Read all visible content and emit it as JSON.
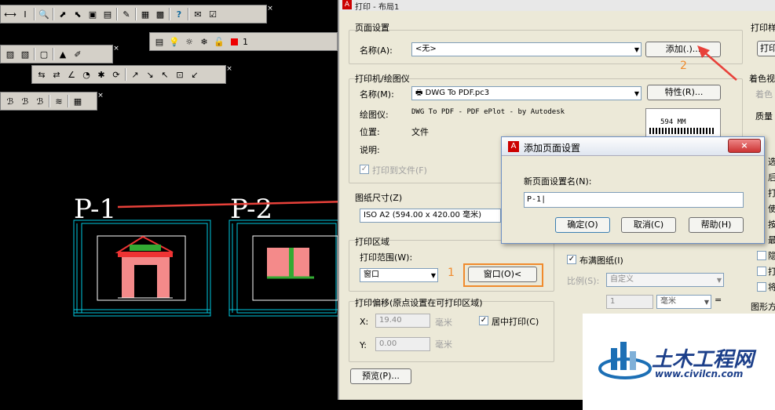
{
  "cad": {
    "toolbar_row5_label": "1",
    "label_p1": "P-1",
    "label_p2": "P-2"
  },
  "dialog": {
    "title": "打印 - 布局1",
    "page_setup": {
      "group": "页面设置",
      "name_label": "名称(A):",
      "name_value": "<无>",
      "add_button": "添加(.)..."
    },
    "plotter": {
      "group": "打印机/绘图仪",
      "name_label": "名称(M):",
      "name_value": "DWG To PDF.pc3",
      "properties_button": "特性(R)...",
      "plotter_label": "绘图仪:",
      "plotter_value": "DWG To PDF - PDF ePlot - by Autodesk",
      "location_label": "位置:",
      "location_value": "文件",
      "description_label": "说明:",
      "print_to_file": "打印到文件(F)",
      "preview_dim": "594 MM"
    },
    "paper": {
      "group": "图纸尺寸(Z)",
      "value": "ISO A2 (594.00 x 420.00 毫米)"
    },
    "area": {
      "group": "打印区域",
      "range_label": "打印范围(W):",
      "range_value": "窗口",
      "window_button": "窗口(O)<"
    },
    "offset": {
      "group": "打印偏移(原点设置在可打印区域)",
      "x_label": "X:",
      "x_value": "19.40",
      "y_label": "Y:",
      "y_value": "0.00",
      "unit": "毫米",
      "center": "居中打印(C)"
    },
    "scale": {
      "fit_paper": "布满图纸(I)",
      "scale_label": "比例(S):",
      "scale_value": "自定义",
      "num_value": "1",
      "unit_value": "毫米",
      "eq": "="
    },
    "preview_button": "预览(P)...",
    "right_panel": {
      "print_style": "打印样",
      "print_btn": "打印",
      "shaded": "着色视",
      "shade_sub": "着色",
      "quality": "质量",
      "opt1": "选",
      "opt2": "后",
      "opt3": "打",
      "opt4": "使",
      "opt5": "按",
      "opt6": "最",
      "opt7": "隐",
      "opt8": "打",
      "opt9": "将",
      "orientation": "图形方"
    }
  },
  "add_page_setup": {
    "title": "添加页面设置",
    "new_name_label": "新页面设置名(N):",
    "new_name_value": "P-1",
    "ok": "确定(O)",
    "cancel": "取消(C)",
    "help": "帮助(H)"
  },
  "annotations": {
    "step1": "1",
    "step2": "2"
  },
  "watermark": {
    "name": "土木工程网",
    "url": "www.civilcn.com"
  },
  "colors": {
    "accent_arrow": "#e8413a",
    "highlight_box": "#f08a2c",
    "drawing_cyan": "#00c8e0"
  }
}
